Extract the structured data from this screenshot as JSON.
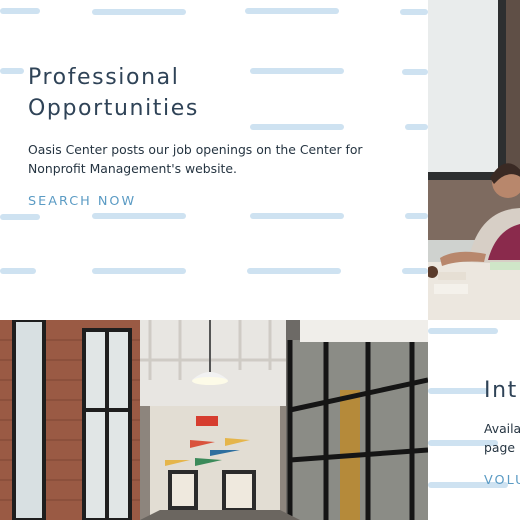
{
  "cards": {
    "professional": {
      "title_line1": "Professional",
      "title_line2": "Opportunities",
      "description": "Oasis Center posts our job openings on the Center for Nonprofit Management's website.",
      "cta_label": "SEARCH NOW"
    },
    "internship": {
      "title_fragment": "Int",
      "description_fragment_line1": "Availa",
      "description_fragment_line2": "page",
      "cta_fragment": "VOLU"
    }
  },
  "colors": {
    "title": "#2f4357",
    "body_text": "#263542",
    "link": "#5b9bc4",
    "pattern_dash": "#c9dff0"
  },
  "images": [
    {
      "name": "meeting-photo",
      "description": "woman smiling at a table in a meeting room"
    },
    {
      "name": "hallway-photo",
      "description": "brick office hallway with glass walls and pendant light"
    }
  ]
}
